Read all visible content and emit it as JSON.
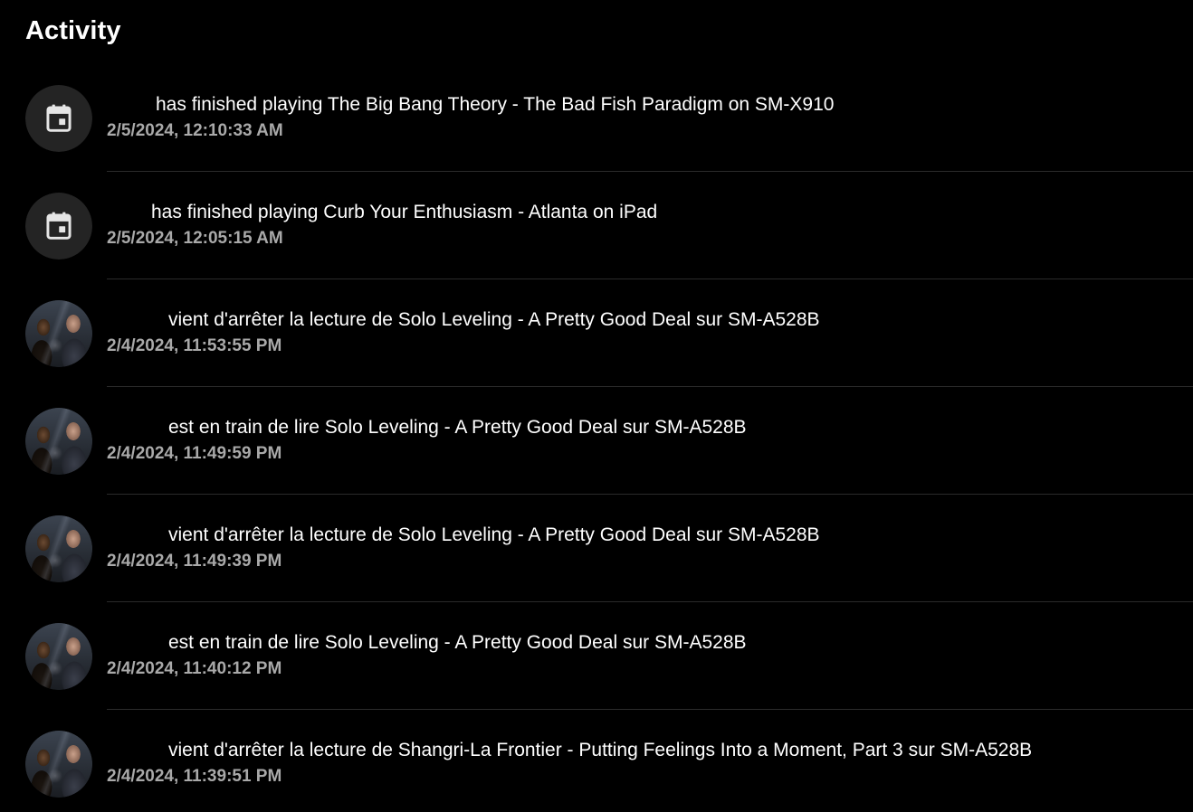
{
  "page": {
    "title": "Activity"
  },
  "colors": {
    "background": "#000000",
    "primary_text": "#ffffff",
    "secondary_text": "#a9a9a9",
    "icon_bg": "#242424",
    "divider": "#2b2b2b"
  },
  "activities": [
    {
      "avatar": "calendar-icon",
      "user": "",
      "message": "has finished playing The Big Bang Theory - The Bad Fish Paradigm on SM-X910",
      "date": "2/5/2024, 12:10:33 AM"
    },
    {
      "avatar": "calendar-icon",
      "user": "",
      "message": "has finished playing Curb Your Enthusiasm - Atlanta on iPad",
      "date": "2/5/2024, 12:05:15 AM"
    },
    {
      "avatar": "user-photo",
      "user": "",
      "message": "vient d'arrêter la lecture de Solo Leveling - A Pretty Good Deal sur SM-A528B",
      "date": "2/4/2024, 11:53:55 PM"
    },
    {
      "avatar": "user-photo",
      "user": "",
      "message": "est en train de lire Solo Leveling - A Pretty Good Deal sur SM-A528B",
      "date": "2/4/2024, 11:49:59 PM"
    },
    {
      "avatar": "user-photo",
      "user": "",
      "message": "vient d'arrêter la lecture de Solo Leveling - A Pretty Good Deal sur SM-A528B",
      "date": "2/4/2024, 11:49:39 PM"
    },
    {
      "avatar": "user-photo",
      "user": "",
      "message": "est en train de lire Solo Leveling - A Pretty Good Deal sur SM-A528B",
      "date": "2/4/2024, 11:40:12 PM"
    },
    {
      "avatar": "user-photo",
      "user": "",
      "message": "vient d'arrêter la lecture de Shangri-La Frontier - Putting Feelings Into a Moment, Part 3 sur SM-A528B",
      "date": "2/4/2024, 11:39:51 PM"
    }
  ]
}
